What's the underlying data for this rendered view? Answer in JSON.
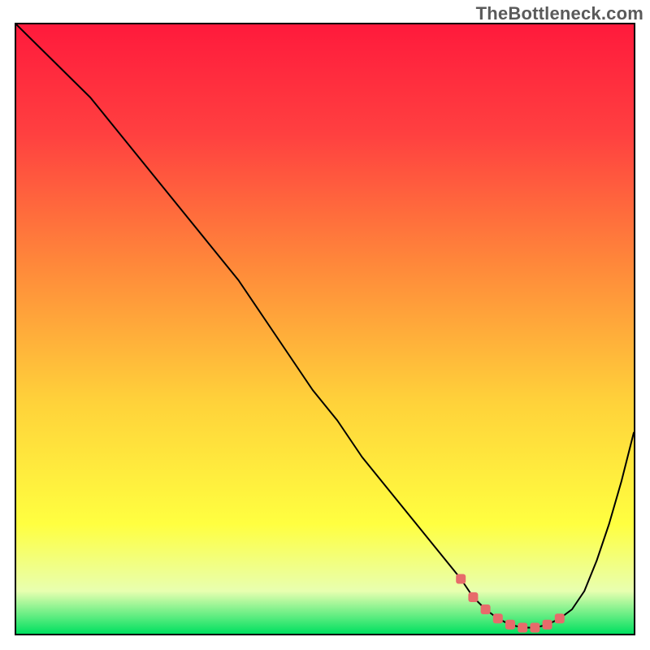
{
  "watermark": "TheBottleneck.com",
  "colors": {
    "gradient_stops": [
      {
        "offset": "0%",
        "color": "#ff1a3c"
      },
      {
        "offset": "18%",
        "color": "#ff4040"
      },
      {
        "offset": "40%",
        "color": "#ff8a3a"
      },
      {
        "offset": "62%",
        "color": "#ffd23a"
      },
      {
        "offset": "82%",
        "color": "#ffff40"
      },
      {
        "offset": "93%",
        "color": "#e8ffb0"
      },
      {
        "offset": "100%",
        "color": "#00e060"
      }
    ],
    "curve": "#000000",
    "marker": "#e76b6b",
    "border": "#000000"
  },
  "chart_data": {
    "type": "line",
    "title": "",
    "xlabel": "",
    "ylabel": "",
    "xlim": [
      0,
      100
    ],
    "ylim": [
      0,
      100
    ],
    "grid": false,
    "legend": false,
    "series": [
      {
        "name": "bottleneck_pct",
        "x": [
          0,
          4,
          8,
          12,
          16,
          20,
          24,
          28,
          32,
          36,
          40,
          44,
          48,
          52,
          56,
          60,
          64,
          68,
          72,
          74,
          76,
          78,
          80,
          82,
          84,
          86,
          88,
          90,
          92,
          94,
          96,
          98,
          100
        ],
        "values": [
          100,
          96,
          92,
          88,
          83,
          78,
          73,
          68,
          63,
          58,
          52,
          46,
          40,
          35,
          29,
          24,
          19,
          14,
          9,
          6,
          4,
          2.5,
          1.5,
          1.0,
          1.0,
          1.5,
          2.5,
          4,
          7,
          12,
          18,
          25,
          33
        ]
      }
    ],
    "highlight": {
      "name": "optimal_region",
      "x": [
        72,
        74,
        76,
        78,
        80,
        82,
        84,
        86,
        88
      ],
      "values": [
        9,
        6,
        4,
        2.5,
        1.5,
        1.0,
        1.0,
        1.5,
        2.5
      ]
    }
  }
}
